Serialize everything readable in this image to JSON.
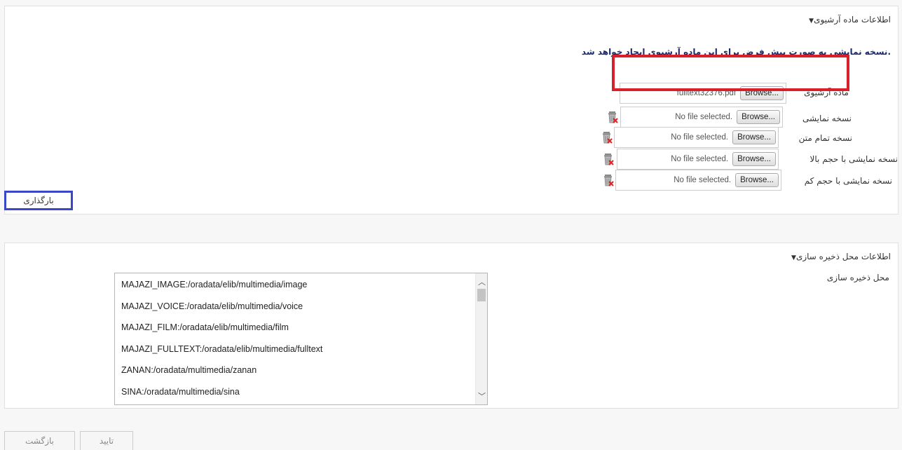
{
  "archive_section": {
    "title": "اطلاعات ماده آرشیوی",
    "default_note": "نسخه نمایشی به صورت پیش فرض برای این ماده آرشیوی ایجاد خواهد شد.",
    "archive_item": {
      "label": "ماده آرشیوی",
      "browse_label": "Browse...",
      "file_name": "fulltext32376.pdf"
    },
    "rows": [
      {
        "label": "نسخه نمایشی",
        "browse_label": "Browse...",
        "file_name": "No file selected."
      },
      {
        "label": "نسخه تمام متن",
        "browse_label": "Browse...",
        "file_name": "No file selected."
      },
      {
        "label": "نسخه نمایشی با حجم بالا",
        "browse_label": "Browse...",
        "file_name": "No file selected."
      },
      {
        "label": "نسخه نمایشی با حجم کم",
        "browse_label": "Browse...",
        "file_name": "No file selected."
      }
    ],
    "upload_label": "بارگذاری"
  },
  "storage_section": {
    "title": "اطلاعات محل ذخیره سازی",
    "location_label": "محل ذخیره سازی",
    "locations": [
      "MAJAZI_IMAGE:/oradata/elib/multimedia/image",
      "MAJAZI_VOICE:/oradata/elib/multimedia/voice",
      "MAJAZI_FILM:/oradata/elib/multimedia/film",
      "MAJAZI_FULLTEXT:/oradata/elib/multimedia/fulltext",
      "ZANAN:/oradata/multimedia/zanan",
      "SINA:/oradata/multimedia/sina"
    ]
  },
  "footer": {
    "confirm_label": "تایید",
    "back_label": "بازگشت"
  },
  "colors": {
    "highlight_red": "#d9202a",
    "highlight_blue": "#3a47c9",
    "note_text": "#1a2a6c"
  }
}
